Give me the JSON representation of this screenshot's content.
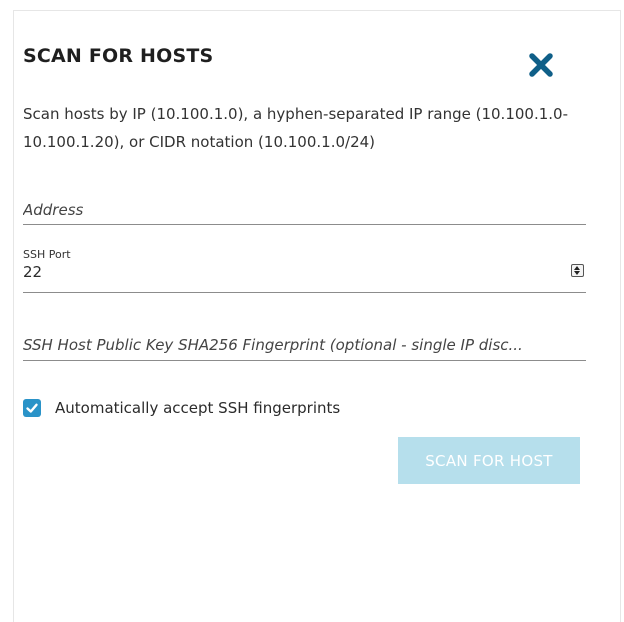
{
  "dialog": {
    "title": "SCAN FOR HOSTS",
    "close_icon": "close-x-icon",
    "description": "Scan hosts by IP (10.100.1.0), a hyphen-separated IP range (10.100.1.0-10.100.1.20), or CIDR notation (10.100.1.0/24)",
    "address": {
      "placeholder": "Address",
      "value": ""
    },
    "ssh_port": {
      "label": "SSH Port",
      "value": "22"
    },
    "fingerprint": {
      "placeholder": "SSH Host Public Key SHA256 Fingerprint (optional - single IP disc...",
      "value": ""
    },
    "auto_accept": {
      "label": "Automatically accept SSH fingerprints",
      "checked": true
    },
    "scan_button_label": "SCAN FOR HOST"
  },
  "colors": {
    "accent": "#2a93c8",
    "close_icon": "#0f5f88",
    "button_disabled_bg": "#b6dfec",
    "button_text": "#ffffff"
  }
}
